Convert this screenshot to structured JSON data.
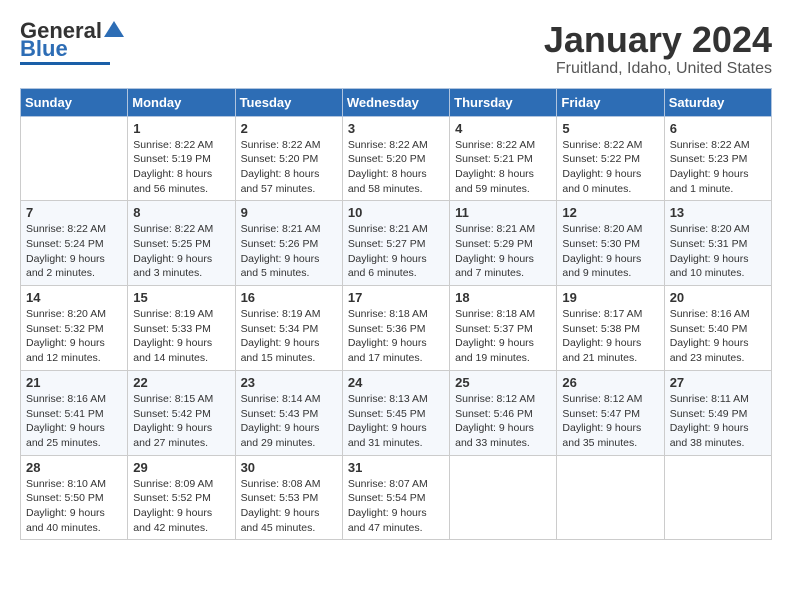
{
  "header": {
    "logo": {
      "line1": "General",
      "line2": "Blue"
    },
    "title": "January 2024",
    "subtitle": "Fruitland, Idaho, United States"
  },
  "columns": [
    "Sunday",
    "Monday",
    "Tuesday",
    "Wednesday",
    "Thursday",
    "Friday",
    "Saturday"
  ],
  "weeks": [
    [
      {
        "day": "",
        "info": ""
      },
      {
        "day": "1",
        "info": "Sunrise: 8:22 AM\nSunset: 5:19 PM\nDaylight: 8 hours\nand 56 minutes."
      },
      {
        "day": "2",
        "info": "Sunrise: 8:22 AM\nSunset: 5:20 PM\nDaylight: 8 hours\nand 57 minutes."
      },
      {
        "day": "3",
        "info": "Sunrise: 8:22 AM\nSunset: 5:20 PM\nDaylight: 8 hours\nand 58 minutes."
      },
      {
        "day": "4",
        "info": "Sunrise: 8:22 AM\nSunset: 5:21 PM\nDaylight: 8 hours\nand 59 minutes."
      },
      {
        "day": "5",
        "info": "Sunrise: 8:22 AM\nSunset: 5:22 PM\nDaylight: 9 hours\nand 0 minutes."
      },
      {
        "day": "6",
        "info": "Sunrise: 8:22 AM\nSunset: 5:23 PM\nDaylight: 9 hours\nand 1 minute."
      }
    ],
    [
      {
        "day": "7",
        "info": "Sunrise: 8:22 AM\nSunset: 5:24 PM\nDaylight: 9 hours\nand 2 minutes."
      },
      {
        "day": "8",
        "info": "Sunrise: 8:22 AM\nSunset: 5:25 PM\nDaylight: 9 hours\nand 3 minutes."
      },
      {
        "day": "9",
        "info": "Sunrise: 8:21 AM\nSunset: 5:26 PM\nDaylight: 9 hours\nand 5 minutes."
      },
      {
        "day": "10",
        "info": "Sunrise: 8:21 AM\nSunset: 5:27 PM\nDaylight: 9 hours\nand 6 minutes."
      },
      {
        "day": "11",
        "info": "Sunrise: 8:21 AM\nSunset: 5:29 PM\nDaylight: 9 hours\nand 7 minutes."
      },
      {
        "day": "12",
        "info": "Sunrise: 8:20 AM\nSunset: 5:30 PM\nDaylight: 9 hours\nand 9 minutes."
      },
      {
        "day": "13",
        "info": "Sunrise: 8:20 AM\nSunset: 5:31 PM\nDaylight: 9 hours\nand 10 minutes."
      }
    ],
    [
      {
        "day": "14",
        "info": "Sunrise: 8:20 AM\nSunset: 5:32 PM\nDaylight: 9 hours\nand 12 minutes."
      },
      {
        "day": "15",
        "info": "Sunrise: 8:19 AM\nSunset: 5:33 PM\nDaylight: 9 hours\nand 14 minutes."
      },
      {
        "day": "16",
        "info": "Sunrise: 8:19 AM\nSunset: 5:34 PM\nDaylight: 9 hours\nand 15 minutes."
      },
      {
        "day": "17",
        "info": "Sunrise: 8:18 AM\nSunset: 5:36 PM\nDaylight: 9 hours\nand 17 minutes."
      },
      {
        "day": "18",
        "info": "Sunrise: 8:18 AM\nSunset: 5:37 PM\nDaylight: 9 hours\nand 19 minutes."
      },
      {
        "day": "19",
        "info": "Sunrise: 8:17 AM\nSunset: 5:38 PM\nDaylight: 9 hours\nand 21 minutes."
      },
      {
        "day": "20",
        "info": "Sunrise: 8:16 AM\nSunset: 5:40 PM\nDaylight: 9 hours\nand 23 minutes."
      }
    ],
    [
      {
        "day": "21",
        "info": "Sunrise: 8:16 AM\nSunset: 5:41 PM\nDaylight: 9 hours\nand 25 minutes."
      },
      {
        "day": "22",
        "info": "Sunrise: 8:15 AM\nSunset: 5:42 PM\nDaylight: 9 hours\nand 27 minutes."
      },
      {
        "day": "23",
        "info": "Sunrise: 8:14 AM\nSunset: 5:43 PM\nDaylight: 9 hours\nand 29 minutes."
      },
      {
        "day": "24",
        "info": "Sunrise: 8:13 AM\nSunset: 5:45 PM\nDaylight: 9 hours\nand 31 minutes."
      },
      {
        "day": "25",
        "info": "Sunrise: 8:12 AM\nSunset: 5:46 PM\nDaylight: 9 hours\nand 33 minutes."
      },
      {
        "day": "26",
        "info": "Sunrise: 8:12 AM\nSunset: 5:47 PM\nDaylight: 9 hours\nand 35 minutes."
      },
      {
        "day": "27",
        "info": "Sunrise: 8:11 AM\nSunset: 5:49 PM\nDaylight: 9 hours\nand 38 minutes."
      }
    ],
    [
      {
        "day": "28",
        "info": "Sunrise: 8:10 AM\nSunset: 5:50 PM\nDaylight: 9 hours\nand 40 minutes."
      },
      {
        "day": "29",
        "info": "Sunrise: 8:09 AM\nSunset: 5:52 PM\nDaylight: 9 hours\nand 42 minutes."
      },
      {
        "day": "30",
        "info": "Sunrise: 8:08 AM\nSunset: 5:53 PM\nDaylight: 9 hours\nand 45 minutes."
      },
      {
        "day": "31",
        "info": "Sunrise: 8:07 AM\nSunset: 5:54 PM\nDaylight: 9 hours\nand 47 minutes."
      },
      {
        "day": "",
        "info": ""
      },
      {
        "day": "",
        "info": ""
      },
      {
        "day": "",
        "info": ""
      }
    ]
  ]
}
